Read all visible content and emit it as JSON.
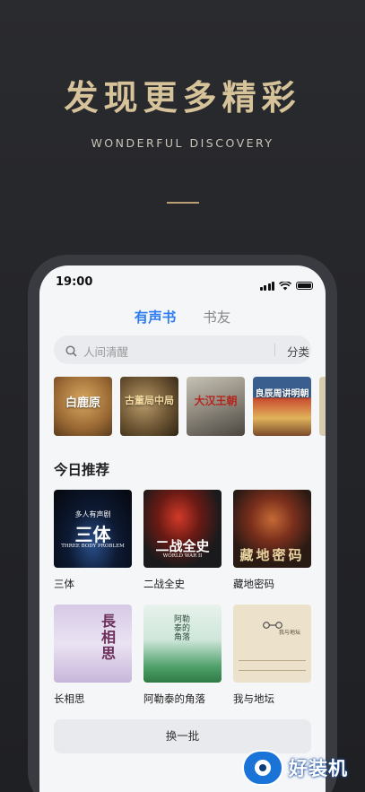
{
  "promo": {
    "headline": "发现更多精彩",
    "subheadline": "WONDERFUL DISCOVERY"
  },
  "status_bar": {
    "time": "19:00"
  },
  "tabs": [
    {
      "label": "有声书",
      "active": true
    },
    {
      "label": "书友",
      "active": false
    }
  ],
  "search": {
    "placeholder": "人间清醒",
    "category_label": "分类"
  },
  "top_covers": [
    {
      "title": "白鹿原"
    },
    {
      "title": "古董局中局"
    },
    {
      "title": "大汉王朝"
    },
    {
      "title": "良辰周讲明朝"
    }
  ],
  "recommend": {
    "title": "今日推荐",
    "books": [
      {
        "name": "三体",
        "cover_text": "三体",
        "cover_sub": "THREE BODY PROBLEM",
        "cover_top": "多人有声剧"
      },
      {
        "name": "二战全史",
        "cover_text": "二战全史",
        "cover_sub": "WORLD WAR II"
      },
      {
        "name": "藏地密码",
        "cover_text": "藏地密码"
      },
      {
        "name": "长相思",
        "cover_text": "長相思"
      },
      {
        "name": "阿勒泰的角落",
        "cover_text": "阿勒泰的角落"
      },
      {
        "name": "我与地坛",
        "cover_text": "我与地坛"
      }
    ]
  },
  "refresh_label": "换一批",
  "watermark": {
    "text": "好装机"
  },
  "colors": {
    "accent": "#2f7cf0",
    "gold": "#d6c39a",
    "background": "#232428"
  }
}
